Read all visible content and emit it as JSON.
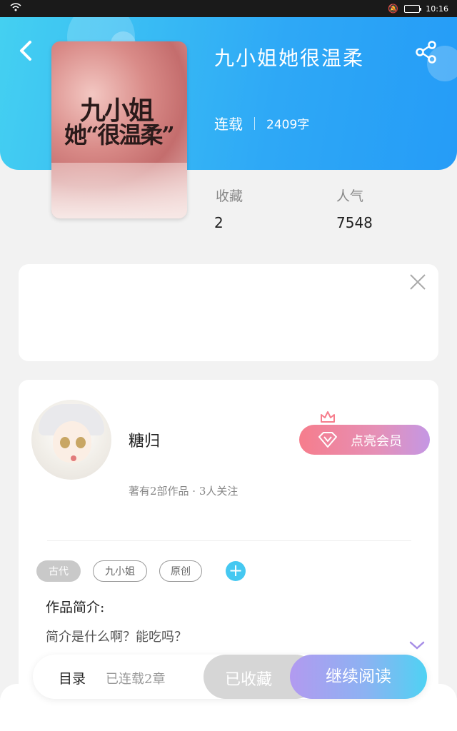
{
  "status_bar": {
    "time": "10:16"
  },
  "book": {
    "title": "九小姐她很温柔",
    "status": "连载",
    "word_count": "2409字",
    "cover_title_line1": "九小姐",
    "cover_title_line2": "她“很温柔”"
  },
  "stats": {
    "favorites_label": "收藏",
    "favorites_value": "2",
    "popularity_label": "人气",
    "popularity_value": "7548"
  },
  "author": {
    "name": "糖归",
    "meta": "著有2部作品 · 3人关注",
    "vip_label": "点亮会员"
  },
  "tags": [
    "古代",
    "九小姐",
    "原创"
  ],
  "intro": {
    "title": "作品简介:",
    "text": "简介是什么啊？能吃吗？"
  },
  "bottom": {
    "toc_label": "目录",
    "chapter_count": "已连载2章",
    "collected_label": "已收藏",
    "read_label": "继续阅读"
  },
  "colors": {
    "header_start": "#44d0f1",
    "header_end": "#259cf7",
    "vip_start": "#f67d8c",
    "vip_end": "#c497e4",
    "read_start": "#b29af0",
    "read_end": "#4fd2f3",
    "tag_add": "#45c8f1"
  },
  "icons": [
    "wifi-icon",
    "mute-bell-icon",
    "battery-icon",
    "back-arrow-icon",
    "share-icon",
    "close-icon",
    "diamond-icon",
    "crown-icon",
    "plus-icon",
    "chevron-down-icon"
  ]
}
